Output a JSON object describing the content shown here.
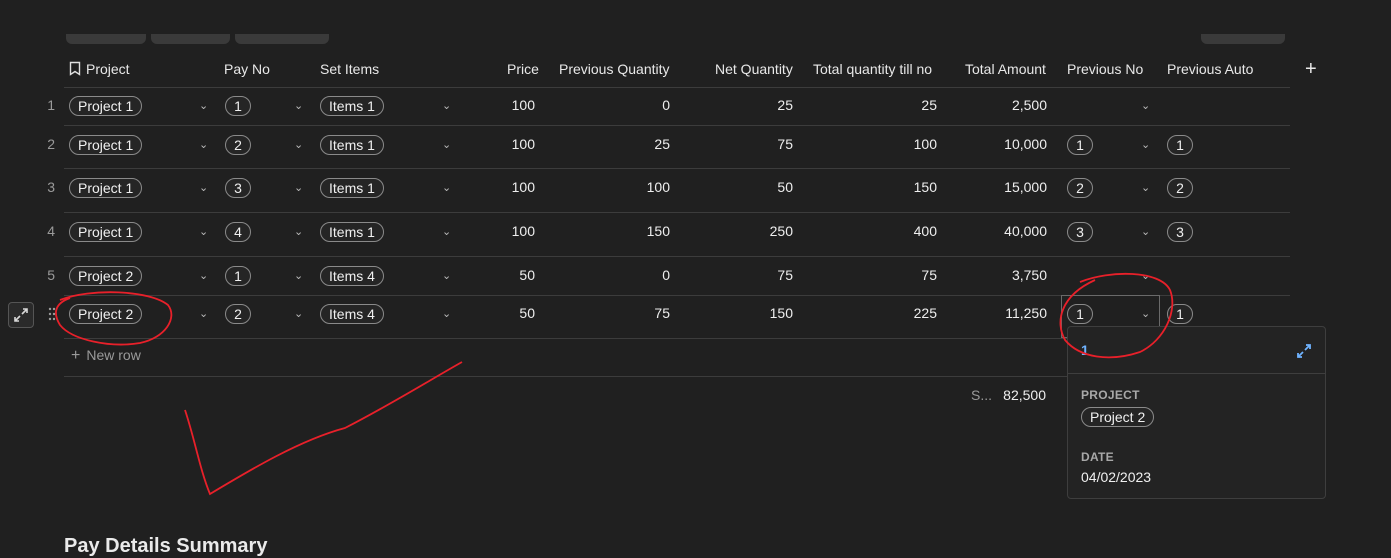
{
  "table": {
    "headers": {
      "project": "Project",
      "pay_no": "Pay No",
      "set_items": "Set Items",
      "price": "Price",
      "previous_quantity": "Previous Quantity",
      "net_quantity": "Net Quantity",
      "total_quantity_till_no": "Total quantity till no",
      "total_amount": "Total Amount",
      "previous_no": "Previous No",
      "previous_auto": "Previous Auto"
    },
    "add_column_label": "+",
    "rows": [
      {
        "index": "1",
        "project": "Project 1",
        "pay_no": "1",
        "set_items": "Items 1",
        "price": "100",
        "previous_quantity": "0",
        "net_quantity": "25",
        "total_quantity": "25",
        "total_amount": "2,500",
        "previous_no": "",
        "previous_auto": ""
      },
      {
        "index": "2",
        "project": "Project 1",
        "pay_no": "2",
        "set_items": "Items 1",
        "price": "100",
        "previous_quantity": "25",
        "net_quantity": "75",
        "total_quantity": "100",
        "total_amount": "10,000",
        "previous_no": "1",
        "previous_auto": "1"
      },
      {
        "index": "3",
        "project": "Project 1",
        "pay_no": "3",
        "set_items": "Items 1",
        "price": "100",
        "previous_quantity": "100",
        "net_quantity": "50",
        "total_quantity": "150",
        "total_amount": "15,000",
        "previous_no": "2",
        "previous_auto": "2"
      },
      {
        "index": "4",
        "project": "Project 1",
        "pay_no": "4",
        "set_items": "Items 1",
        "price": "100",
        "previous_quantity": "150",
        "net_quantity": "250",
        "total_quantity": "400",
        "total_amount": "40,000",
        "previous_no": "3",
        "previous_auto": "3"
      },
      {
        "index": "5",
        "project": "Project 2",
        "pay_no": "1",
        "set_items": "Items 4",
        "price": "50",
        "previous_quantity": "0",
        "net_quantity": "75",
        "total_quantity": "75",
        "total_amount": "3,750",
        "previous_no": "",
        "previous_auto": ""
      },
      {
        "index": "",
        "project": "Project 2",
        "pay_no": "2",
        "set_items": "Items 4",
        "price": "50",
        "previous_quantity": "75",
        "net_quantity": "150",
        "total_quantity": "225",
        "total_amount": "11,250",
        "previous_no": "1",
        "previous_auto": "1"
      }
    ],
    "new_row_label": "New row",
    "summary_label": "S...",
    "summary_value": "82,500"
  },
  "popup": {
    "title": "1",
    "project_label": "PROJECT",
    "project_value": "Project 2",
    "date_label": "DATE",
    "date_value": "04/02/2023"
  },
  "footer_heading": "Pay Details Summary",
  "icons": {
    "project_header": "bookmark-icon",
    "expand_row": "expand-icon",
    "drag_handle": "drag-handle-icon",
    "popup_expand": "expand-icon",
    "dropdown": "chevron-down-icon"
  },
  "colors": {
    "background": "#202020",
    "annotation": "#e8202a",
    "popup_title": "#6fb3ff"
  }
}
